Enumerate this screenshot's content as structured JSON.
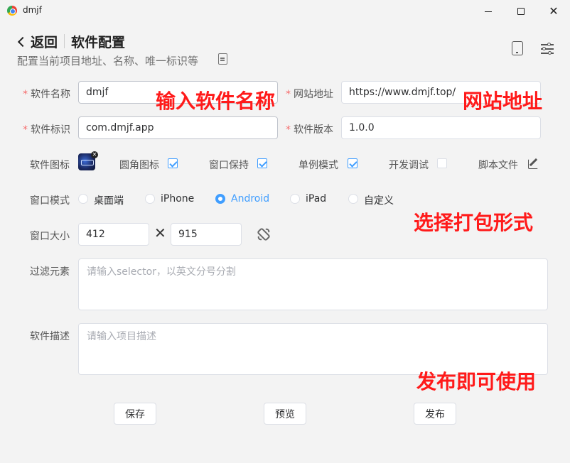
{
  "window": {
    "title": "dmjf"
  },
  "header": {
    "back_label": "返回",
    "title": "软件配置",
    "subtitle": "配置当前项目地址、名称、唯一标识等"
  },
  "form": {
    "name": {
      "label": "软件名称",
      "value": "dmjf"
    },
    "url": {
      "label": "网站地址",
      "value": "https://www.dmjf.top/"
    },
    "id": {
      "label": "软件标识",
      "value": "com.dmjf.app"
    },
    "version": {
      "label": "软件版本",
      "value": "1.0.0"
    },
    "icon": {
      "label": "软件图标"
    },
    "rounded_icon": {
      "label": "圆角图标",
      "checked": true
    },
    "keep_window": {
      "label": "窗口保持",
      "checked": true
    },
    "single_instance": {
      "label": "单例模式",
      "checked": true
    },
    "dev_debug": {
      "label": "开发调试",
      "checked": false
    },
    "script_file": {
      "label": "脚本文件"
    },
    "window_mode": {
      "label": "窗口模式",
      "options": [
        "桌面端",
        "iPhone",
        "Android",
        "iPad",
        "自定义"
      ],
      "selected": "Android"
    },
    "window_size": {
      "label": "窗口大小",
      "width": "412",
      "height": "915",
      "separator": "✕"
    },
    "filter": {
      "label": "过滤元素",
      "placeholder": "请输入selector，以英文分号分割"
    },
    "description": {
      "label": "软件描述",
      "placeholder": "请输入项目描述"
    }
  },
  "actions": {
    "save": "保存",
    "preview": "预览",
    "publish": "发布"
  },
  "annotations": {
    "name_hint": "输入软件名称",
    "url_hint": "网站地址",
    "mode_hint": "选择打包形式",
    "publish_hint": "发布即可使用"
  },
  "colors": {
    "primary": "#409eff",
    "required": "#f56c6c",
    "annotation": "#ff1a1a"
  }
}
